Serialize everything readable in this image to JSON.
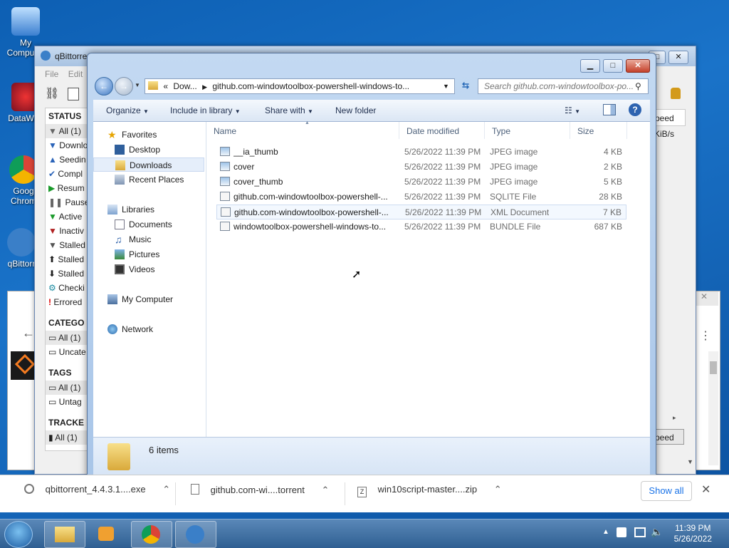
{
  "desktop": {
    "icons": [
      {
        "label": "My Computer"
      },
      {
        "label": "DataWag"
      },
      {
        "label": "Goog Chrom"
      },
      {
        "label": "qBittorr"
      }
    ]
  },
  "qbittorrent": {
    "title": "qBittorrent",
    "menu": [
      "File",
      "Edit"
    ],
    "status_header": "STATUS",
    "status_items": [
      "All (1)",
      "Downlo",
      "Seedin",
      "Compl",
      "Resum",
      "Paused",
      "Active",
      "Inactiv",
      "Stalled",
      "Stalled",
      "Stalled",
      "Checki",
      "Errored"
    ],
    "categories_header": "CATEGO",
    "categories": [
      "All (1)",
      "Uncate"
    ],
    "tags_header": "TAGS",
    "tags": [
      "All (1)",
      "Untag"
    ],
    "trackers_header": "TRACKE",
    "trackers": [
      "All (1)"
    ],
    "speed_col": "peed",
    "speed_val": "KiB/s",
    "speed_btn": "peed"
  },
  "explorer": {
    "address_prefix": "«",
    "address_parts": [
      "Dow...",
      "github.com-windowtoolbox-powershell-windows-to..."
    ],
    "search_placeholder": "Search github.com-windowtoolbox-po...",
    "toolbar": {
      "organize": "Organize",
      "include": "Include in library",
      "share": "Share with",
      "new_folder": "New folder"
    },
    "nav": {
      "favorites": "Favorites",
      "desktop": "Desktop",
      "downloads": "Downloads",
      "recent": "Recent Places",
      "libraries": "Libraries",
      "documents": "Documents",
      "music": "Music",
      "pictures": "Pictures",
      "videos": "Videos",
      "computer": "My Computer",
      "network": "Network"
    },
    "columns": {
      "name": "Name",
      "date": "Date modified",
      "type": "Type",
      "size": "Size"
    },
    "files": [
      {
        "name": "__ia_thumb",
        "date": "5/26/2022 11:39 PM",
        "type": "JPEG image",
        "size": "4 KB"
      },
      {
        "name": "cover",
        "date": "5/26/2022 11:39 PM",
        "type": "JPEG image",
        "size": "2 KB"
      },
      {
        "name": "cover_thumb",
        "date": "5/26/2022 11:39 PM",
        "type": "JPEG image",
        "size": "5 KB"
      },
      {
        "name": "github.com-windowtoolbox-powershell-...",
        "date": "5/26/2022 11:39 PM",
        "type": "SQLITE File",
        "size": "28 KB"
      },
      {
        "name": "github.com-windowtoolbox-powershell-...",
        "date": "5/26/2022 11:39 PM",
        "type": "XML Document",
        "size": "7 KB"
      },
      {
        "name": "windowtoolbox-powershell-windows-to...",
        "date": "5/26/2022 11:39 PM",
        "type": "BUNDLE File",
        "size": "687 KB"
      }
    ],
    "status_count": "6 items"
  },
  "downloads": {
    "items": [
      "qbittorrent_4.4.3.1....exe",
      "github.com-wi....torrent",
      "win10script-master....zip"
    ],
    "show_all": "Show all"
  },
  "taskbar": {
    "time": "11:39 PM",
    "date": "5/26/2022"
  },
  "colors": {
    "accent": "#1a73c9",
    "selection": "#e5eefa"
  }
}
